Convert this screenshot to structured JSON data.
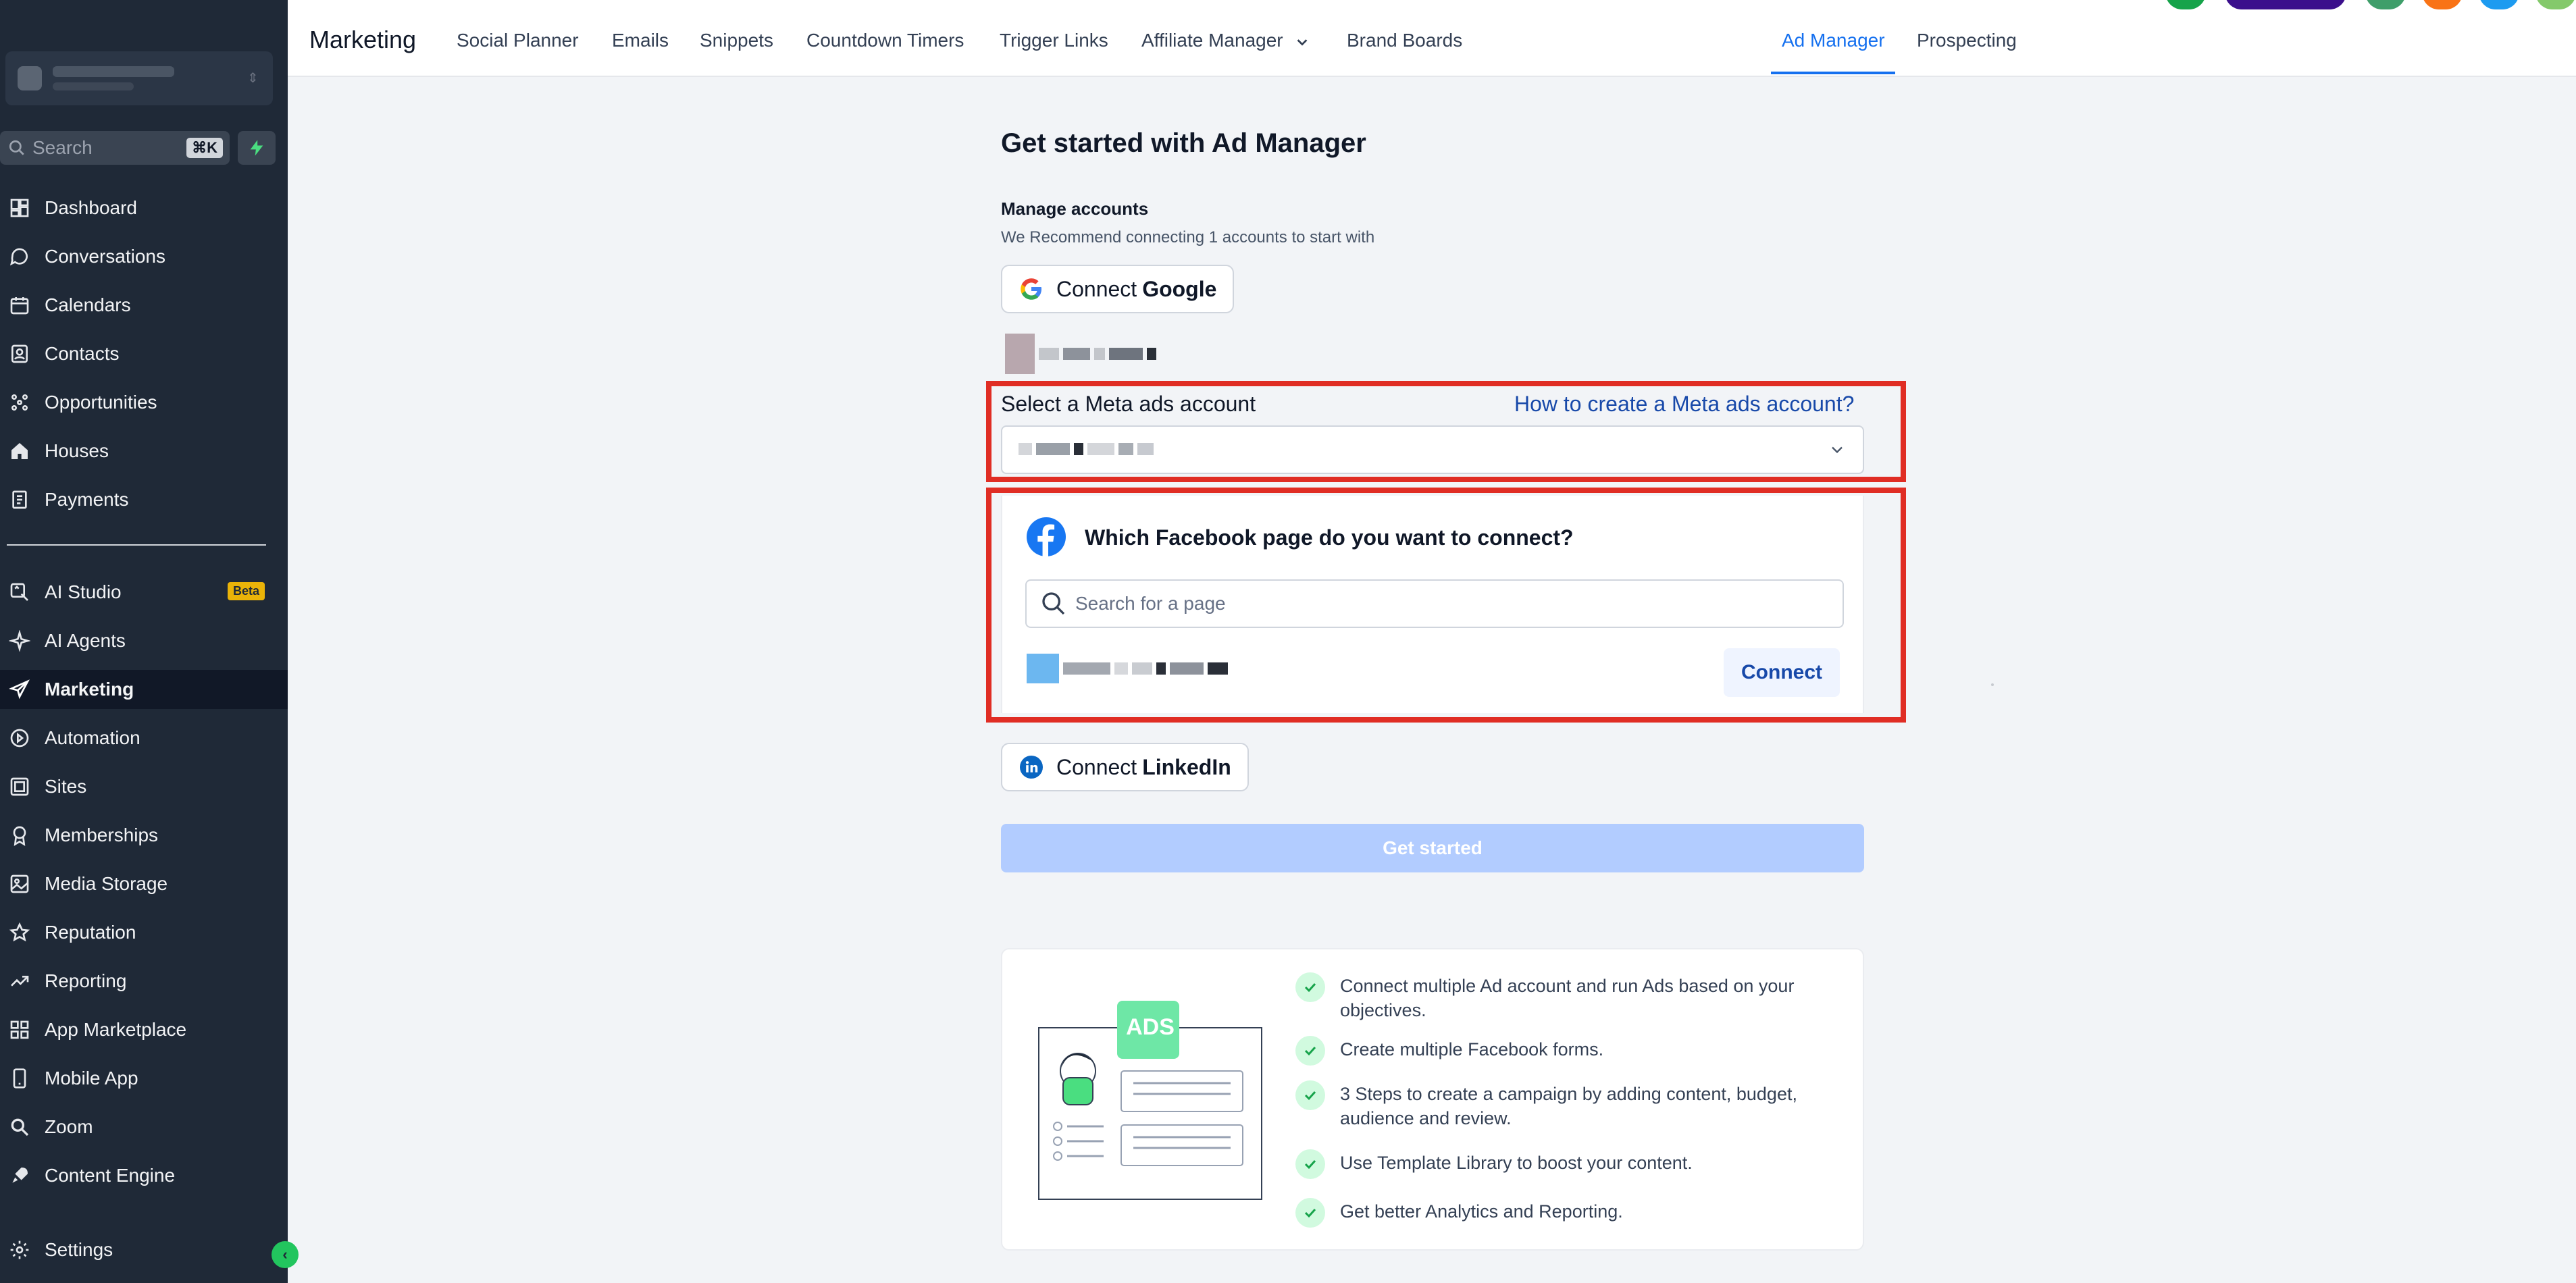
{
  "sidebar": {
    "search": {
      "placeholder": "Search",
      "shortcut": "⌘K"
    },
    "items": [
      {
        "label": "Dashboard",
        "icon": "dashboard-icon"
      },
      {
        "label": "Conversations",
        "icon": "chat-icon"
      },
      {
        "label": "Calendars",
        "icon": "calendar-icon"
      },
      {
        "label": "Contacts",
        "icon": "contacts-icon"
      },
      {
        "label": "Opportunities",
        "icon": "opportunities-icon"
      },
      {
        "label": "Houses",
        "icon": "house-icon"
      },
      {
        "label": "Payments",
        "icon": "payments-icon"
      },
      {
        "label": "AI Studio",
        "icon": "ai-studio-icon",
        "badge": "Beta"
      },
      {
        "label": "AI Agents",
        "icon": "sparkle-icon"
      },
      {
        "label": "Marketing",
        "icon": "send-icon",
        "active": true
      },
      {
        "label": "Automation",
        "icon": "automation-icon"
      },
      {
        "label": "Sites",
        "icon": "sites-icon"
      },
      {
        "label": "Memberships",
        "icon": "badge-icon"
      },
      {
        "label": "Media Storage",
        "icon": "image-icon"
      },
      {
        "label": "Reputation",
        "icon": "star-icon"
      },
      {
        "label": "Reporting",
        "icon": "trend-icon"
      },
      {
        "label": "App Marketplace",
        "icon": "grid-icon"
      },
      {
        "label": "Mobile App",
        "icon": "phone-icon"
      },
      {
        "label": "Zoom",
        "icon": "zoom-icon"
      },
      {
        "label": "Content Engine",
        "icon": "rocket-icon"
      },
      {
        "label": "Settings",
        "icon": "gear-icon"
      }
    ]
  },
  "topbar": {
    "title": "Marketing",
    "tabs": [
      {
        "label": "Social Planner"
      },
      {
        "label": "Emails"
      },
      {
        "label": "Snippets"
      },
      {
        "label": "Countdown Timers"
      },
      {
        "label": "Trigger Links"
      },
      {
        "label": "Affiliate Manager"
      },
      {
        "label": "Brand Boards"
      },
      {
        "label": "Ad Manager",
        "active": true
      },
      {
        "label": "Prospecting"
      }
    ]
  },
  "main": {
    "title": "Get started with Ad Manager",
    "manage_label": "Manage accounts",
    "manage_sub": "We Recommend connecting 1 accounts to start with",
    "google_btn": {
      "prefix": "Connect",
      "brand": "Google"
    },
    "meta": {
      "label": "Select a Meta ads account",
      "help_link": "How to create a Meta ads account?"
    },
    "facebook": {
      "question": "Which Facebook page do you want to connect?",
      "search_placeholder": "Search for a page",
      "connect_label": "Connect"
    },
    "linkedin_btn": {
      "prefix": "Connect",
      "brand": "LinkedIn"
    },
    "get_started": "Get started",
    "illustration_badge": "ADS",
    "features": [
      "Connect multiple Ad account and run Ads based on your objectives.",
      "Create multiple Facebook forms.",
      "3 Steps to create a campaign by adding content, budget, audience and review.",
      "Use Template Library to boost your content.",
      "Get better Analytics and Reporting."
    ]
  },
  "colors": {
    "sidebar_bg": "#1f2937",
    "accent": "#1570ef",
    "highlight": "#e02d24",
    "success": "#22c55e"
  }
}
